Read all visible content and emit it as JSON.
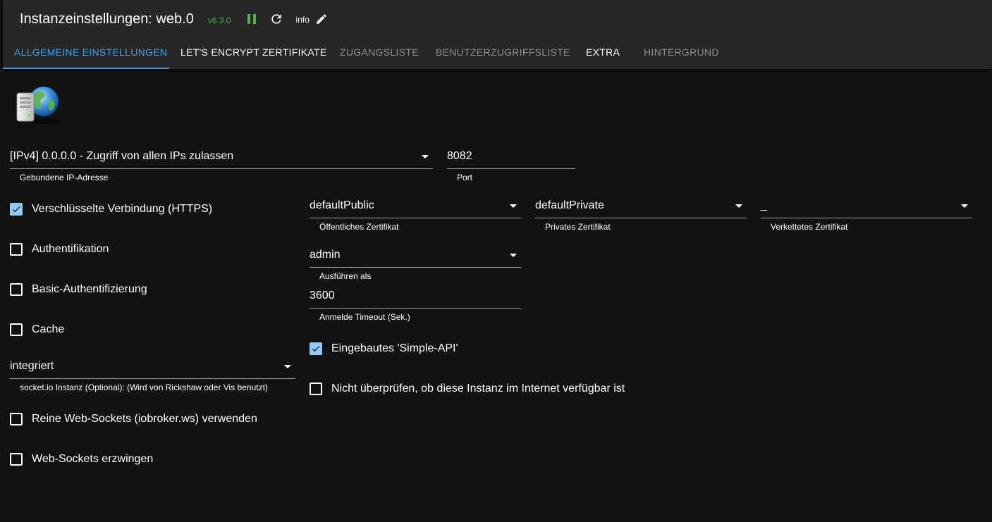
{
  "header": {
    "title": "Instanzeinstellungen: web.0",
    "version": "v6.3.0",
    "info_label": "info"
  },
  "tabs": [
    {
      "label": "ALLGEMEINE EINSTELLUNGEN",
      "active": true
    },
    {
      "label": "LET'S ENCRYPT ZERTIFIKATE"
    },
    {
      "label": "ZUGANGSLISTE"
    },
    {
      "label": "BENUTZERZUGRIFFSLISTE"
    },
    {
      "label": "EXTRA"
    },
    {
      "label": "HINTERGRUND"
    }
  ],
  "fields": {
    "bind": {
      "value": "[IPv4] 0.0.0.0 - Zugriff von allen IPs zulassen",
      "help": "Gebundene IP-Adresse"
    },
    "port": {
      "value": "8082",
      "help": "Port"
    },
    "cert_public": {
      "value": "defaultPublic",
      "help": "Öffentliches Zertifikat"
    },
    "cert_private": {
      "value": "defaultPrivate",
      "help": "Privates Zertifikat"
    },
    "cert_chained": {
      "value": "_",
      "help": "Verkettetes Zertifikat"
    },
    "default_user": {
      "value": "admin",
      "help": "Ausführen als"
    },
    "ttl": {
      "value": "3600",
      "help": "Anmelde Timeout (Sek.)"
    },
    "socketio": {
      "value": "integriert",
      "help": "socket.io Instanz (Optional): (Wird von Rickshaw oder Vis benutzt)"
    }
  },
  "checkboxes": {
    "https": {
      "label": "Verschlüsselte Verbindung (HTTPS)",
      "checked": true
    },
    "auth": {
      "label": "Authentifikation",
      "checked": false
    },
    "basic_auth": {
      "label": "Basic-Authentifizierung",
      "checked": false
    },
    "cache": {
      "label": "Cache",
      "checked": false
    },
    "simple_api": {
      "label": "Eingebautes 'Simple-API'",
      "checked": true
    },
    "no_check": {
      "label": "Nicht überprüfen, ob diese Instanz im Internet verfügbar ist",
      "checked": false
    },
    "pure_ws": {
      "label": "Reine Web-Sockets (iobroker.ws) verwenden",
      "checked": false
    },
    "force_ws": {
      "label": "Web-Sockets erzwingen",
      "checked": false
    }
  },
  "colors": {
    "accent": "#3f9fe8",
    "running": "#4caf50",
    "checkbox_checked": "#90caf9",
    "header_bg": "#272727",
    "page_bg": "#121212"
  },
  "icons": {
    "logo": "web-adapter-globe-server-icon",
    "pause": "pause-icon",
    "reload": "reload-icon",
    "edit": "pencil-icon",
    "dropdown": "chevron-down-icon"
  }
}
